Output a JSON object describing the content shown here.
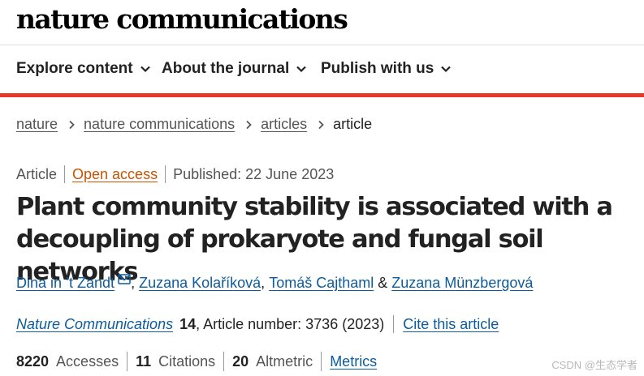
{
  "header": {
    "logo": "nature communications"
  },
  "nav": {
    "items": [
      {
        "label": "Explore content"
      },
      {
        "label": "About the journal"
      },
      {
        "label": "Publish with us"
      }
    ]
  },
  "breadcrumb": {
    "items": [
      "nature",
      "nature communications",
      "articles"
    ],
    "current": "article"
  },
  "article": {
    "type": "Article",
    "access": "Open access",
    "published": "Published: 22 June 2023",
    "title": "Plant community stability is associated with a decoupling of prokaryote and fungal soil networks",
    "authors": [
      "Dina in ’t Zandt",
      "Zuzana Kolaříková",
      "Tomáš Cajthaml",
      "Zuzana Münzbergová"
    ],
    "author_sep_1": ", ",
    "author_sep_2": ", ",
    "author_sep_3": " & ",
    "journal": "Nature Communications",
    "volume": "14",
    "article_number": ", Article number: 3736 (2023)",
    "cite_label": "Cite this article"
  },
  "metrics": {
    "accesses_value": "8220",
    "accesses_label": "Accesses",
    "citations_value": "11",
    "citations_label": "Citations",
    "altmetric_value": "20",
    "altmetric_label": "Altmetric",
    "metrics_link": "Metrics"
  },
  "watermark": "CSDN @生态学者",
  "colors": {
    "accent_red": "#e8382b",
    "link_blue": "#0c5b9e",
    "open_access_orange": "#c65301"
  }
}
